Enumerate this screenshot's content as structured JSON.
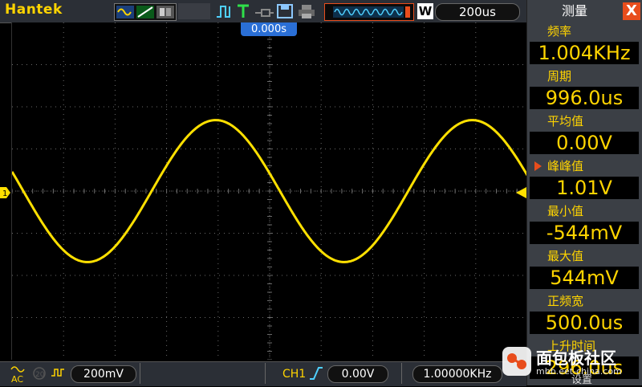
{
  "brand": "Hantek",
  "top": {
    "timebase": "200us",
    "trigger_time": "0.000s",
    "w_label": "W"
  },
  "bottom": {
    "ch1_volts": "200mV",
    "trigger_source": "CH1",
    "trigger_level": "0.00V",
    "frequency": "1.00000KHz"
  },
  "panel": {
    "title": "测量",
    "close": "X",
    "measurements": [
      {
        "label": "频率",
        "value": "1.004KHz"
      },
      {
        "label": "周期",
        "value": "996.0us"
      },
      {
        "label": "平均值",
        "value": "0.00V"
      },
      {
        "label": "峰峰值",
        "value": "1.01V"
      },
      {
        "label": "最小值",
        "value": "-544mV"
      },
      {
        "label": "最大值",
        "value": "544mV"
      },
      {
        "label": "正频宽",
        "value": "500.0us"
      },
      {
        "label": "上升时间",
        "value": "296.0us"
      }
    ],
    "selected_index": 3
  },
  "watermark": {
    "text": "面包板社区",
    "url": "mbb.eet-china.com",
    "bottom_label": "设置"
  },
  "colors": {
    "trace": "#ffe000",
    "accent": "#e84d1c",
    "grid": "#6a6a6a"
  }
}
